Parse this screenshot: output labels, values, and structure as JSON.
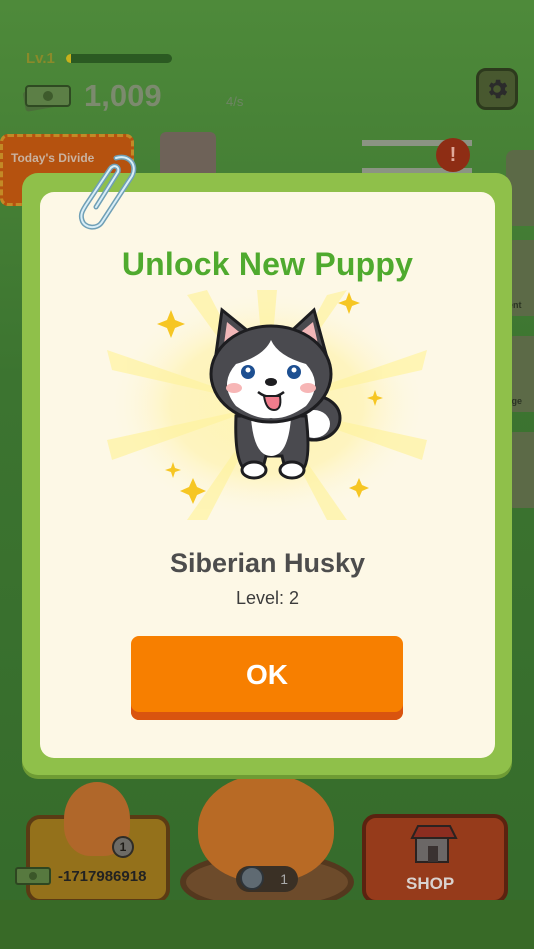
{
  "hud": {
    "level_label": "Lv.1",
    "xp_progress": 0.05,
    "money": "1,009",
    "rate": "4/s",
    "settings_icon": "gear-icon"
  },
  "background": {
    "dividend_label": "Today's Divide",
    "bottom_left_value": "-1717986918",
    "bottom_left_badge": "1",
    "timer_value": "1",
    "shop_label": "SHOP"
  },
  "side_tabs": [
    "",
    "ent",
    "rge"
  ],
  "modal": {
    "title": "Unlock New Puppy",
    "puppy_name": "Siberian Husky",
    "puppy_level": "Level: 2",
    "ok_label": "OK"
  },
  "colors": {
    "title_green": "#4faa2e",
    "ok_orange": "#f77f00",
    "modal_border": "#8fc04a",
    "modal_bg": "#fdf8e6"
  }
}
